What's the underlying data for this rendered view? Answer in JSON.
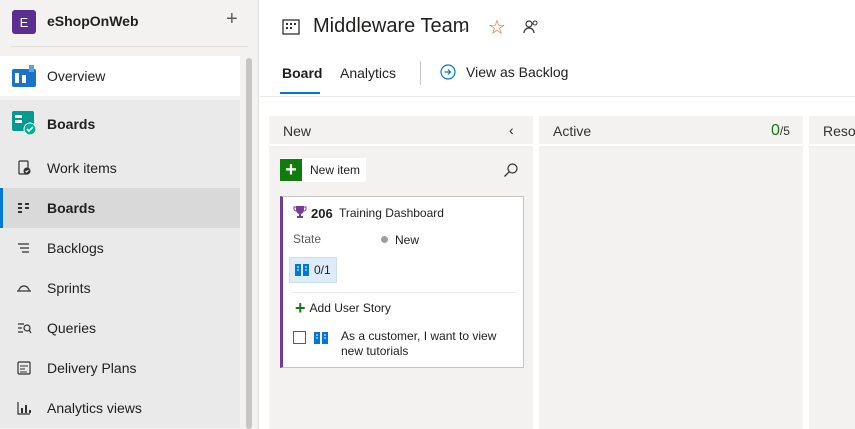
{
  "project": {
    "initial": "E",
    "name": "eShopOnWeb",
    "color": "#5c2e91"
  },
  "sidebar": {
    "overview": "Overview",
    "group": "Boards",
    "items": [
      {
        "label": "Work items",
        "icon": "work-items-icon"
      },
      {
        "label": "Boards",
        "icon": "boards-icon",
        "selected": true
      },
      {
        "label": "Backlogs",
        "icon": "backlogs-icon"
      },
      {
        "label": "Sprints",
        "icon": "sprints-icon"
      },
      {
        "label": "Queries",
        "icon": "queries-icon"
      },
      {
        "label": "Delivery Plans",
        "icon": "delivery-plans-icon"
      },
      {
        "label": "Analytics views",
        "icon": "analytics-views-icon"
      }
    ]
  },
  "header": {
    "team": "Middleware Team",
    "tabs": {
      "board": "Board",
      "analytics": "Analytics"
    },
    "view_as_backlog": "View as Backlog"
  },
  "columns": {
    "new": {
      "title": "New",
      "new_item": "New item"
    },
    "active": {
      "title": "Active",
      "wip_current": "0",
      "wip_limit": "/5"
    },
    "resolved": {
      "title": "Resolved"
    }
  },
  "card": {
    "id": "206",
    "title": "Training Dashboard",
    "state_label": "State",
    "state_value": "New",
    "children": "0/1",
    "add_story": "Add User Story",
    "child_story": "As a customer, I want to view new tutorials"
  },
  "colors": {
    "accent": "#0078d4",
    "epic": "#773b93",
    "green": "#107c10",
    "star": "#d86d28"
  }
}
